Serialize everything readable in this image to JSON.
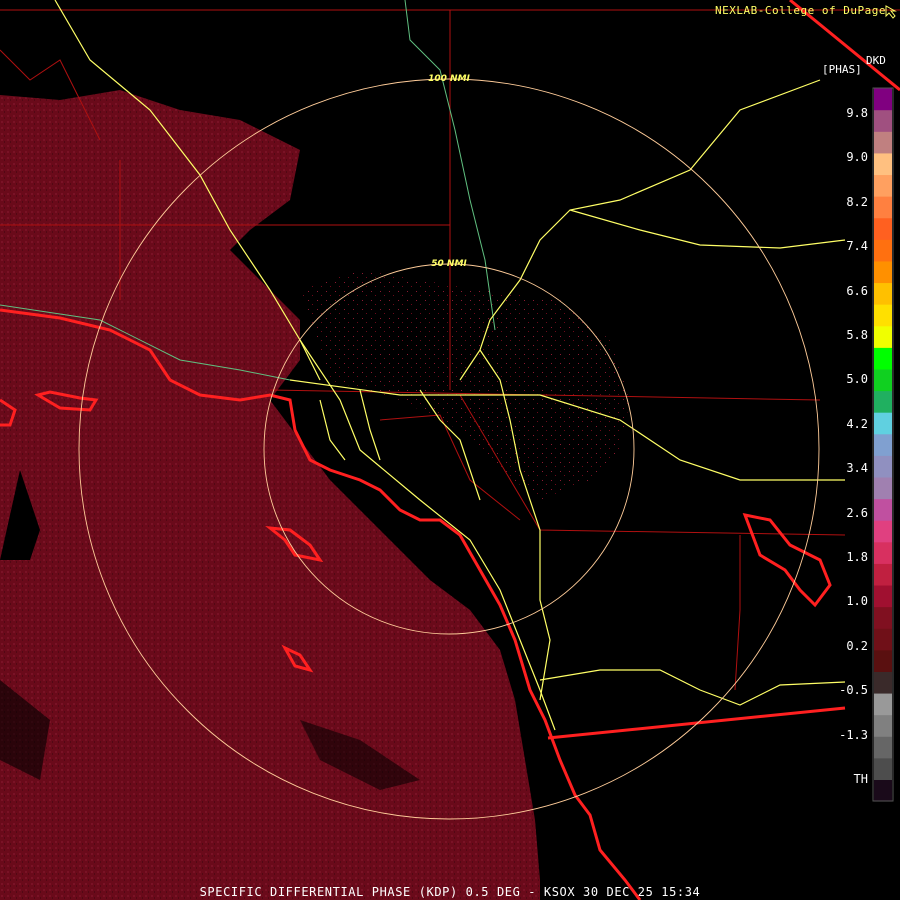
{
  "credit": "NEXLAB-College of DuPage",
  "credit_icon": "cursor-arrow-icon",
  "product": {
    "code": "DKD",
    "unit": "[PHAS]",
    "caption": "SPECIFIC DIFFERENTIAL PHASE (KDP) 0.5 DEG - KSOX 30 DEC 25 15:34"
  },
  "range_rings": [
    {
      "label": "100 NMI"
    },
    {
      "label": "50 NMI"
    }
  ],
  "legend": {
    "ticks": [
      "9.8",
      "9.0",
      "8.2",
      "7.4",
      "6.6",
      "5.8",
      "5.0",
      "4.2",
      "3.4",
      "2.6",
      "1.8",
      "1.0",
      "0.2",
      "-0.5",
      "-1.3",
      "TH"
    ],
    "colors": [
      "#1a0a1a",
      "#4d4d4d",
      "#666666",
      "#808080",
      "#999999",
      "#3a2a2a",
      "#5a1010",
      "#701018",
      "#801020",
      "#a01030",
      "#c02040",
      "#d83060",
      "#e04080",
      "#c050a0",
      "#a080b0",
      "#9090c0",
      "#80a0d0",
      "#60d0e0",
      "#20b060",
      "#10d020",
      "#00ff00",
      "#f0ff00",
      "#ffe000",
      "#ffc000",
      "#ff9000",
      "#ff7010",
      "#ff6020",
      "#ff8040",
      "#ffa060",
      "#ffc080",
      "#c08080",
      "#a05080",
      "#800080"
    ],
    "colors_order": "bottom-to-top"
  },
  "map_colors": {
    "background": "#000000",
    "echo_fill": "#6a0a1a",
    "echo_speckle": "#8a1a30",
    "coastline": "#ff2020",
    "county_lines": "#b01010",
    "highways": "#ffff66",
    "rivers": "#60c080",
    "rings": "#ffcc99"
  }
}
